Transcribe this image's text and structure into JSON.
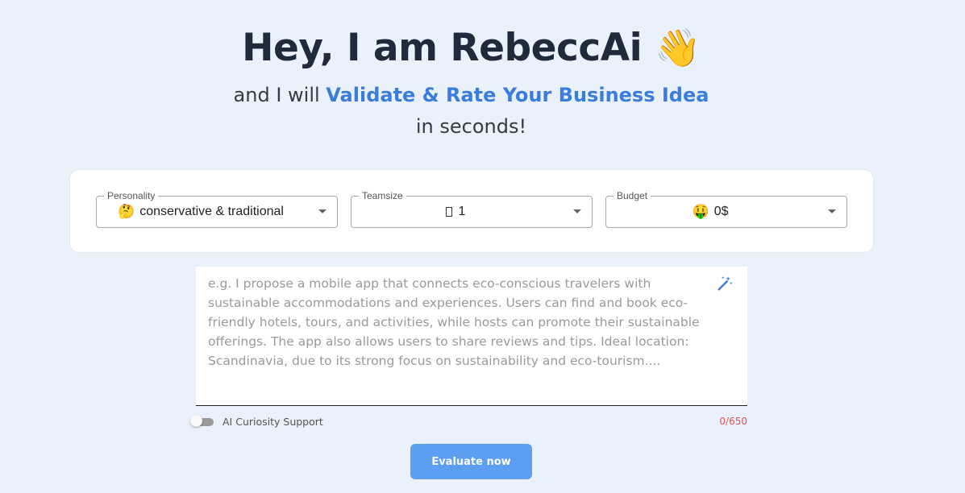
{
  "hero": {
    "title": "Hey, I am RebeccAi",
    "title_emoji": "👋",
    "subtitle_prefix": "and I will ",
    "subtitle_highlight": "Validate & Rate Your Business Idea",
    "subtitle_suffix": " in seconds!"
  },
  "settings": {
    "personality": {
      "label": "Personality",
      "emoji": "🤔",
      "value": "conservative & traditional"
    },
    "teamsize": {
      "label": "Teamsize",
      "value": "1"
    },
    "budget": {
      "label": "Budget",
      "emoji": "🤑",
      "value": "0$"
    }
  },
  "idea": {
    "placeholder": "e.g. I propose a mobile app that connects eco-conscious travelers with sustainable accommodations and experiences. Users can find and book eco-friendly hotels, tours, and activities, while hosts can promote their sustainable offerings. The app also allows users to share reviews and tips. Ideal location: Scandinavia, due to its strong focus on sustainability and eco-tourism....",
    "value": ""
  },
  "footer": {
    "toggle_label": "AI Curiosity Support",
    "char_count": "0/650",
    "evaluate_label": "Evaluate now"
  },
  "colors": {
    "background": "#ebf1fb",
    "accent": "#3b7ddd",
    "button": "#5c9ef2",
    "counter": "#e35151"
  }
}
